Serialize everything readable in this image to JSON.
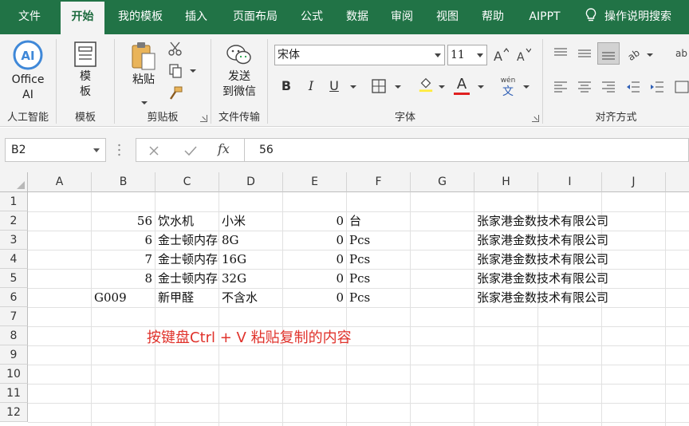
{
  "menu": {
    "tabs": [
      "文件",
      "开始",
      "我的模板",
      "插入",
      "页面布局",
      "公式",
      "数据",
      "审阅",
      "视图",
      "帮助",
      "AIPPT"
    ],
    "active_tab": "开始",
    "help_search": "操作说明搜索"
  },
  "ribbon": {
    "ai_group": {
      "button": [
        "Office",
        "AI"
      ],
      "label": "人工智能"
    },
    "template_group": {
      "button": [
        "模",
        "板"
      ],
      "label": "模板"
    },
    "clipboard_group": {
      "paste": "粘贴",
      "label": "剪贴板"
    },
    "file_transfer_group": {
      "button": [
        "发送",
        "到微信"
      ],
      "label": "文件传输"
    },
    "font_group": {
      "font_name": "宋体",
      "font_size": "11",
      "bold": "B",
      "italic": "I",
      "underline": "U",
      "font_color_glyph": "A",
      "phonetic_glyph": "wén",
      "phonetic_char": "文",
      "label": "字体"
    },
    "align_group": {
      "label": "对齐方式"
    }
  },
  "formula_bar": {
    "name_box": "B2",
    "fx_label": "fx",
    "content": "56"
  },
  "sheet": {
    "columns": [
      "A",
      "B",
      "C",
      "D",
      "E",
      "F",
      "G",
      "H",
      "I",
      "J"
    ],
    "rows": [
      "1",
      "2",
      "3",
      "4",
      "5",
      "6",
      "7",
      "8",
      "9",
      "10",
      "11",
      "12"
    ],
    "data": [
      {
        "b": "56",
        "c": "饮水机",
        "d": "小米",
        "e": "0",
        "f": "台",
        "h": "张家港金数技术有限公司"
      },
      {
        "b": "6",
        "c": "金士顿内存条",
        "d": "8G",
        "e": "0",
        "f": "Pcs",
        "h": "张家港金数技术有限公司"
      },
      {
        "b": "7",
        "c": "金士顿内存条",
        "d": "16G",
        "e": "0",
        "f": "Pcs",
        "h": "张家港金数技术有限公司"
      },
      {
        "b": "8",
        "c": "金士顿内存条",
        "d": "32G",
        "e": "0",
        "f": "Pcs",
        "h": "张家港金数技术有限公司"
      },
      {
        "b": "G009",
        "c": "新甲醛",
        "d": "不含水",
        "e": "0",
        "f": "Pcs",
        "h": "张家港金数技术有限公司"
      }
    ],
    "annotation": "按键盘Ctrl + V 粘贴复制的内容"
  }
}
